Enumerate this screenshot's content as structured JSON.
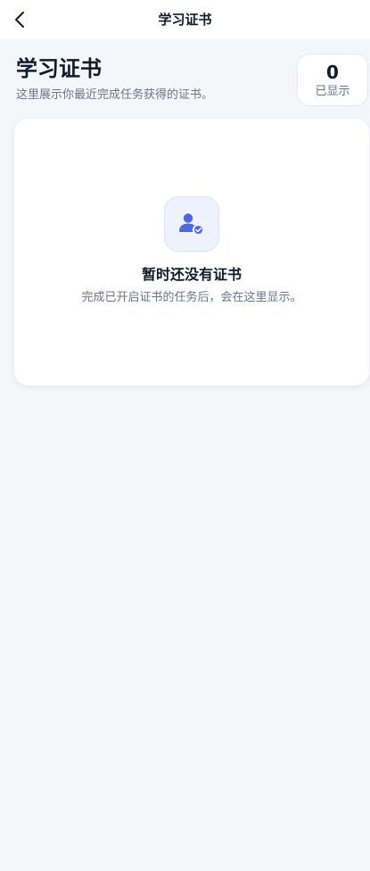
{
  "nav": {
    "title": "学习证书",
    "back_icon": "chevron-left-icon"
  },
  "header": {
    "title": "学习证书",
    "subtitle": "这里展示你最近完成任务获得的证书。"
  },
  "count_card": {
    "value": "0",
    "label": "已显示"
  },
  "empty_state": {
    "icon": "user-check-icon",
    "title": "暂时还没有证书",
    "description": "完成已开启证书的任务后，会在这里显示。"
  },
  "colors": {
    "background": "#f5f6fa",
    "accent": "#4a67e6",
    "text_primary": "#0f1a2e",
    "text_secondary": "#6b7487"
  }
}
